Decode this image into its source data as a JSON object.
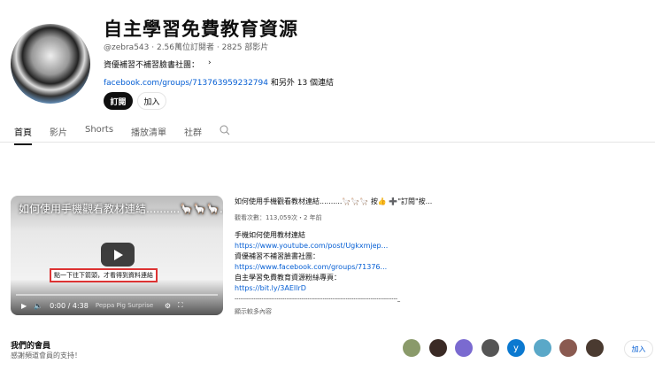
{
  "channel": {
    "title": "自主學習免費教育資源",
    "handle": "@zebra543",
    "subscribers": "2.56萬位訂閱者",
    "videos": "2825 部影片",
    "more_text": "資優補習不補習臉書社團：",
    "more_chevron": "›",
    "link": "facebook.com/groups/713763959232794",
    "link_suffix": "和另外 13 個連結",
    "subscribe": "訂閱",
    "join": "加入"
  },
  "tabs": [
    {
      "label": "首頁"
    },
    {
      "label": "影片"
    },
    {
      "label": "Shorts"
    },
    {
      "label": "播放清單"
    },
    {
      "label": "社群"
    }
  ],
  "video": {
    "title": "如何使用手機觀看教材連結..........🦙🦙🦙...",
    "overlay_note": "點一下往下箭頭，才看得到資料連結",
    "time": "0:00 / 4:38",
    "next_title": "Peppa Pig Surprise（佩佩豬）"
  },
  "description": {
    "title": "如何使用手機觀看教材連結..........🦙🦙🦙  按👍 ➕\"訂閱\"按...",
    "stats": "觀看次數：113,059次・2 年前",
    "lines": [
      {
        "text": "手機如何使用教材連結"
      },
      {
        "link": "https://www.youtube.com/post/Ugkxmjep..."
      },
      {
        "text": "資優補習不補習臉書社團："
      },
      {
        "link": "https://www.facebook.com/groups/71376..."
      },
      {
        "text": "自主學習免費教育資源粉絲專頁："
      },
      {
        "link": "https://bit.ly/3AEIlrD"
      }
    ],
    "separator": "-------------------------------------------------------------------------------------_",
    "show_more": "顯示較多內容"
  },
  "members": {
    "title": "我們的會員",
    "subtitle": "感謝頻道會員的支持！",
    "avatar_letter": "y",
    "join": "加入",
    "colors": [
      "#8a9a6a",
      "#3a2a25",
      "#7a6ad0",
      "#555",
      "#0b79d0",
      "#5aa8c8",
      "#8a5a50",
      "#4a3a30"
    ]
  }
}
